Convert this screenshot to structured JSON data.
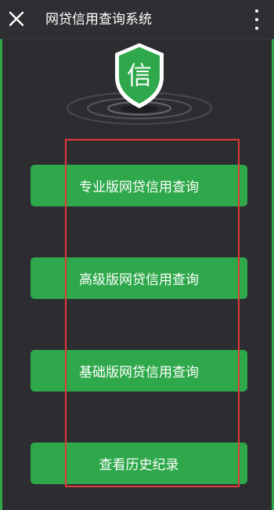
{
  "header": {
    "title": "网贷信用查询系统",
    "close_icon": "close-icon",
    "more_icon": "more-vertical-icon"
  },
  "logo": {
    "shield_char": "信",
    "shield_color": "#2ea84a"
  },
  "menu": {
    "items": [
      {
        "label": "专业版网贷信用查询"
      },
      {
        "label": "高级版网贷信用查询"
      },
      {
        "label": "基础版网贷信用查询"
      },
      {
        "label": "查看历史纪录"
      }
    ]
  },
  "colors": {
    "accent_green": "#2ea84a",
    "highlight_red": "#e0393a",
    "background": "#2e2e33"
  }
}
